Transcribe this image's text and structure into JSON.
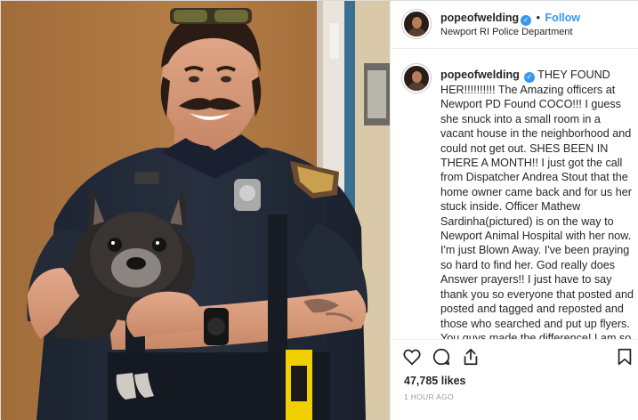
{
  "post": {
    "username": "popeofwelding",
    "follow_label": "Follow",
    "separator": "•",
    "location": "Newport RI Police Department",
    "caption_username": "popeofwelding",
    "caption_text": "THEY FOUND HER!!!!!!!!!! The Amazing officers at Newport PD Found COCO!!! I guess she snuck into a small room in a vacant house in the neighborhood and could not get out. SHES BEEN IN THERE A MONTH!! I just got the call from Dispatcher Andrea Stout that the home owner came back and for us her stuck inside. Officer Mathew Sardinha(pictured) is on the way to Newport Animal Hospital with her now. I'm just Blown Away. I've been praying so hard to find her. God really does Answer prayers!! I just have to say thank you so everyone that posted and posted and tagged and reposted and those who searched and put up flyers. You guys made the difference! I am so thankful that you all did this!!",
    "likes": "47,785 likes",
    "time_ago": "1 HOUR AGO"
  },
  "icons": {
    "verified": "verified-badge-icon",
    "like": "heart-icon",
    "comment": "comment-bubble-icon",
    "share": "share-icon",
    "save": "bookmark-icon"
  },
  "colors": {
    "link_blue": "#3897f0",
    "text": "#262626",
    "muted": "#999999",
    "divider": "#efefef"
  }
}
